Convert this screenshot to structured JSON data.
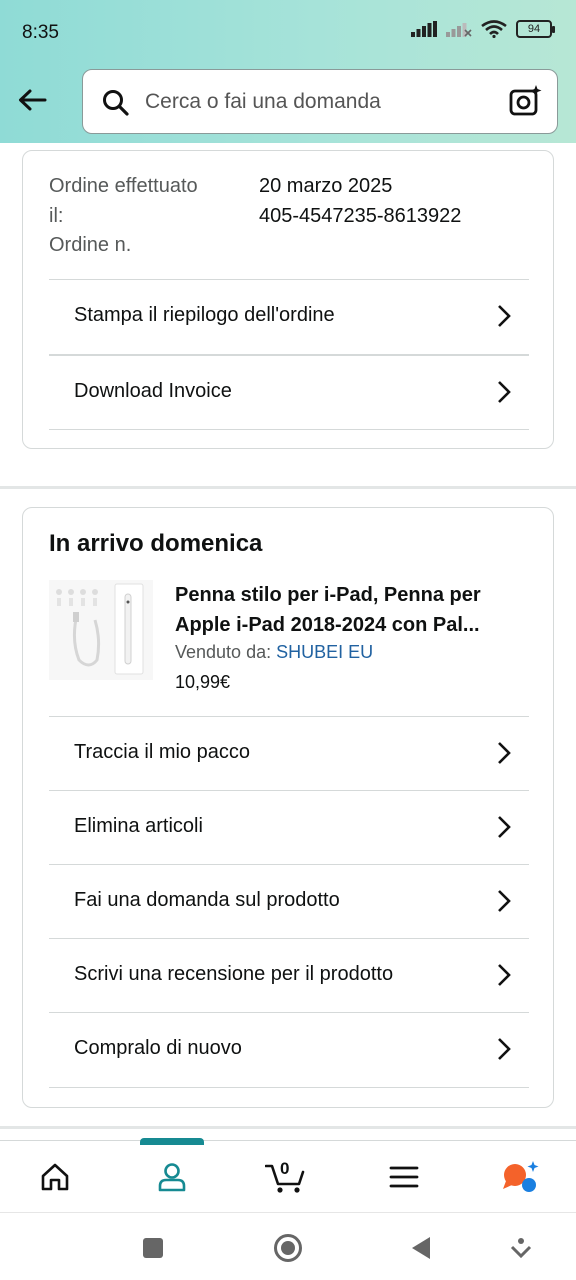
{
  "status_bar": {
    "time": "8:35",
    "battery": "94",
    "icons": [
      "signal-icon",
      "signal-no-data-icon",
      "wifi-icon",
      "battery-icon"
    ]
  },
  "search": {
    "placeholder": "Cerca o fai una domanda"
  },
  "order_info": {
    "placed_label": "Ordine effettuato il:",
    "placed_label_line1": "Ordine effettuato",
    "placed_label_line2": "il:",
    "number_label": "Ordine n.",
    "date": "20 marzo 2025",
    "number": "405-4547235-8613922"
  },
  "order_actions": [
    {
      "label": "Stampa il riepilogo dell'ordine"
    },
    {
      "label": "Download Invoice"
    }
  ],
  "shipment": {
    "title": "In arrivo domenica",
    "product": {
      "title": "Penna stilo per i-Pad, Penna per Apple i-Pad 2018-2024 con Pal...",
      "title_line1": "Penna stilo per i-Pad, Penna per",
      "title_line2": "Apple i-Pad 2018-2024 con Pal...",
      "seller_prefix": "Venduto da: ",
      "seller_name": "SHUBEI EU",
      "price": "10,99€"
    },
    "actions": [
      {
        "label": "Traccia il mio pacco"
      },
      {
        "label": "Elimina articoli"
      },
      {
        "label": "Fai una domanda sul prodotto"
      },
      {
        "label": "Scrivi una recensione per il prodotto"
      },
      {
        "label": "Compralo di nuovo"
      }
    ]
  },
  "bottom_nav": {
    "items": [
      "home-icon",
      "account-icon",
      "cart-icon",
      "menu-icon",
      "rufus-icon"
    ],
    "active": "account-icon",
    "cart_count": "0"
  },
  "colors": {
    "header_gradient_start": "#8fdbd6",
    "header_gradient_end": "#b7e7d5",
    "accent": "#168a92",
    "link": "#2162a1"
  }
}
